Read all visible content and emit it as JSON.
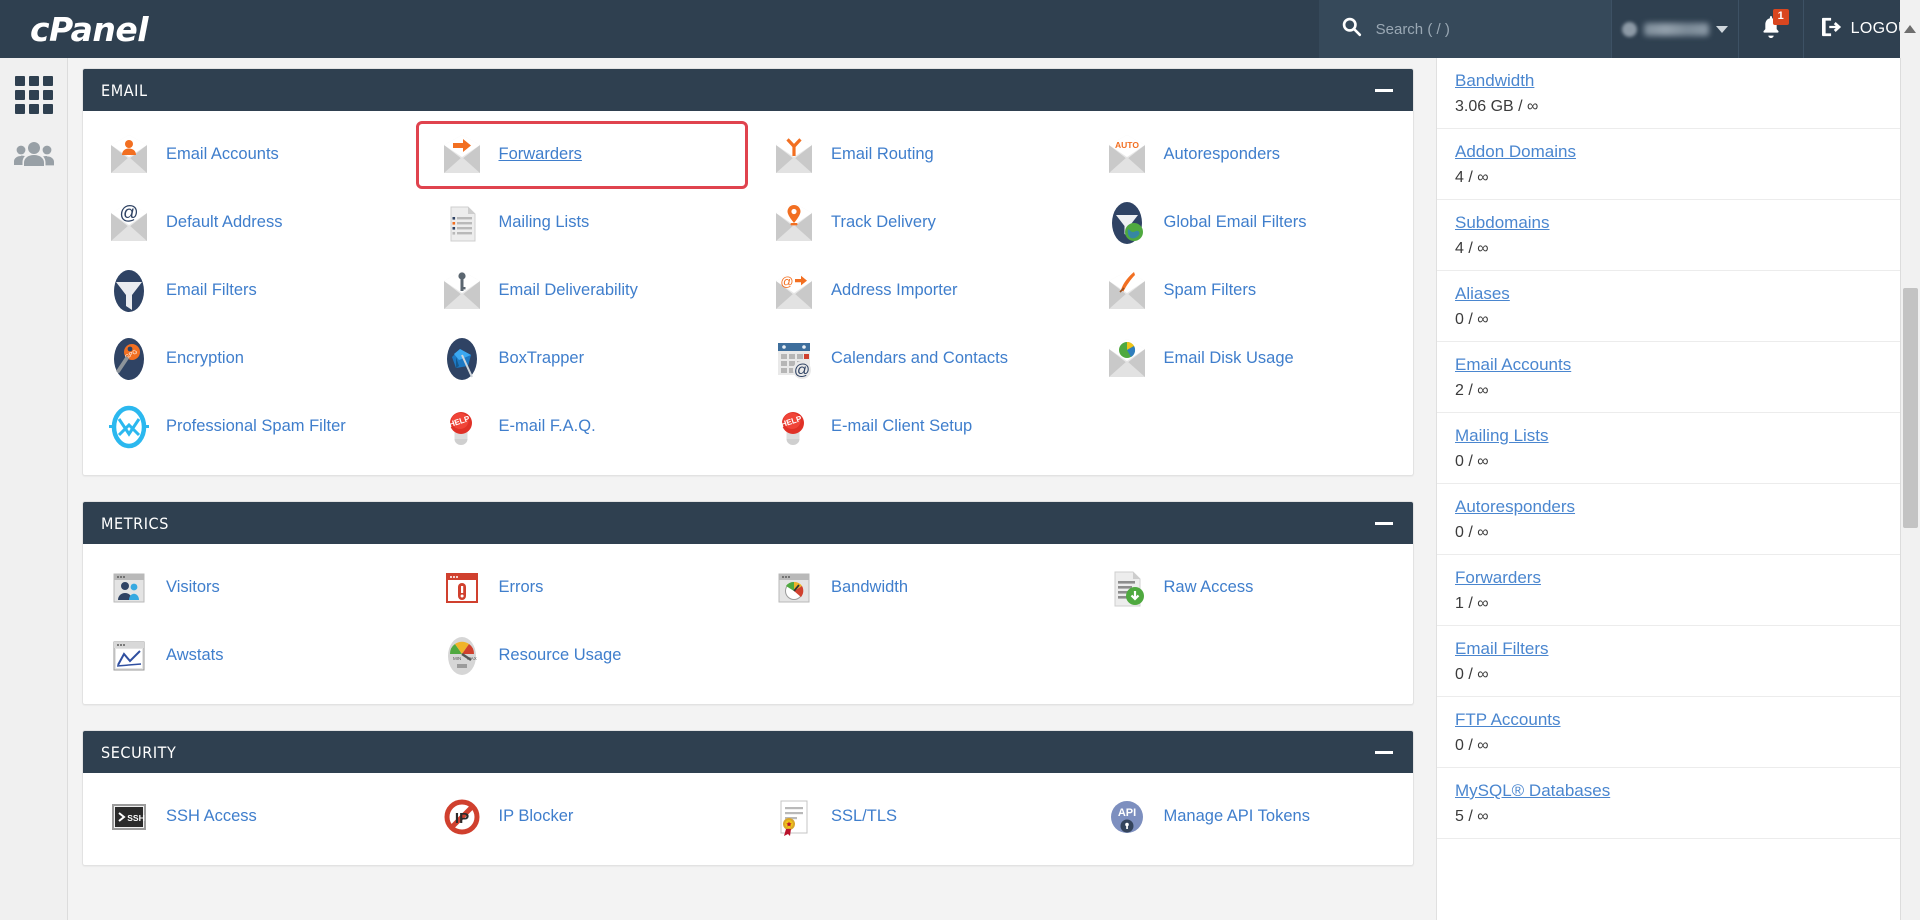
{
  "header": {
    "logo_text": "cPanel",
    "search_placeholder": "Search ( / )",
    "search_icon": "search-icon",
    "user_name": "",
    "user_caret_icon": "chevron-down-icon",
    "notifications_icon": "bell-icon",
    "notifications_count": "1",
    "logout_label": "LOGOUT",
    "logout_icon": "logout-icon"
  },
  "left_rail": {
    "items": [
      {
        "name": "apps-grid-icon",
        "title": "Tools"
      },
      {
        "name": "user-manager-icon",
        "title": "User Manager"
      }
    ]
  },
  "sections": [
    {
      "id": "email",
      "title": "EMAIL",
      "collapse_label": "—",
      "tiles": [
        {
          "label": "Email Accounts",
          "icon": "envelope-person-icon",
          "selected": false
        },
        {
          "label": "Forwarders",
          "icon": "envelope-arrow-icon",
          "selected": true
        },
        {
          "label": "Email Routing",
          "icon": "envelope-routing-icon",
          "selected": false
        },
        {
          "label": "Autoresponders",
          "icon": "envelope-auto-icon",
          "selected": false
        },
        {
          "label": "Default Address",
          "icon": "envelope-at-icon",
          "selected": false
        },
        {
          "label": "Mailing Lists",
          "icon": "list-document-icon",
          "selected": false
        },
        {
          "label": "Track Delivery",
          "icon": "envelope-pin-icon",
          "selected": false
        },
        {
          "label": "Global Email Filters",
          "icon": "funnel-globe-icon",
          "selected": false
        },
        {
          "label": "Email Filters",
          "icon": "funnel-icon",
          "selected": false
        },
        {
          "label": "Email Deliverability",
          "icon": "envelope-key-icon",
          "selected": false
        },
        {
          "label": "Address Importer",
          "icon": "envelope-at-arrow-icon",
          "selected": false
        },
        {
          "label": "Spam Filters",
          "icon": "envelope-quill-icon",
          "selected": false
        },
        {
          "label": "Encryption",
          "icon": "gpg-key-icon",
          "selected": false
        },
        {
          "label": "BoxTrapper",
          "icon": "box-trap-icon",
          "selected": false
        },
        {
          "label": "Calendars and Contacts",
          "icon": "calendar-at-icon",
          "selected": false
        },
        {
          "label": "Email Disk Usage",
          "icon": "envelope-piechart-icon",
          "selected": false
        },
        {
          "label": "Professional Spam Filter",
          "icon": "spam-filter-ring-icon",
          "selected": false
        },
        {
          "label": "E-mail F.A.Q.",
          "icon": "help-button-icon",
          "selected": false
        },
        {
          "label": "E-mail Client Setup",
          "icon": "help-button-icon",
          "selected": false
        }
      ]
    },
    {
      "id": "metrics",
      "title": "METRICS",
      "collapse_label": "—",
      "tiles": [
        {
          "label": "Visitors",
          "icon": "visitors-window-icon",
          "selected": false
        },
        {
          "label": "Errors",
          "icon": "errors-window-icon",
          "selected": false
        },
        {
          "label": "Bandwidth",
          "icon": "bandwidth-gauge-icon",
          "selected": false
        },
        {
          "label": "Raw Access",
          "icon": "raw-access-download-icon",
          "selected": false
        },
        {
          "label": "Awstats",
          "icon": "awstats-chart-icon",
          "selected": false
        },
        {
          "label": "Resource Usage",
          "icon": "resource-usage-gauge-icon",
          "selected": false
        }
      ]
    },
    {
      "id": "security",
      "title": "SECURITY",
      "collapse_label": "—",
      "tiles": [
        {
          "label": "SSH Access",
          "icon": "ssh-terminal-icon",
          "selected": false
        },
        {
          "label": "IP Blocker",
          "icon": "ip-blocker-icon",
          "selected": false
        },
        {
          "label": "SSL/TLS",
          "icon": "ssl-certificate-icon",
          "selected": false
        },
        {
          "label": "Manage API Tokens",
          "icon": "api-token-icon",
          "selected": false
        }
      ]
    }
  ],
  "stats": {
    "items": [
      {
        "label": "Bandwidth",
        "value": "3.06 GB / ∞"
      },
      {
        "label": "Addon Domains",
        "value": "4 / ∞"
      },
      {
        "label": "Subdomains",
        "value": "4 / ∞"
      },
      {
        "label": "Aliases",
        "value": "0 / ∞"
      },
      {
        "label": "Email Accounts",
        "value": "2 / ∞"
      },
      {
        "label": "Mailing Lists",
        "value": "0 / ∞"
      },
      {
        "label": "Autoresponders",
        "value": "0 / ∞"
      },
      {
        "label": "Forwarders",
        "value": "1 / ∞"
      },
      {
        "label": "Email Filters",
        "value": "0 / ∞"
      },
      {
        "label": "FTP Accounts",
        "value": "0 / ∞"
      },
      {
        "label": "MySQL® Databases",
        "value": "5 / ∞"
      }
    ]
  },
  "colors": {
    "header_bg": "#2f4050",
    "link_blue": "#3f7ecc",
    "accent_orange": "#f26f21",
    "highlight_red": "#e0434e",
    "badge_red": "#d9461f"
  }
}
